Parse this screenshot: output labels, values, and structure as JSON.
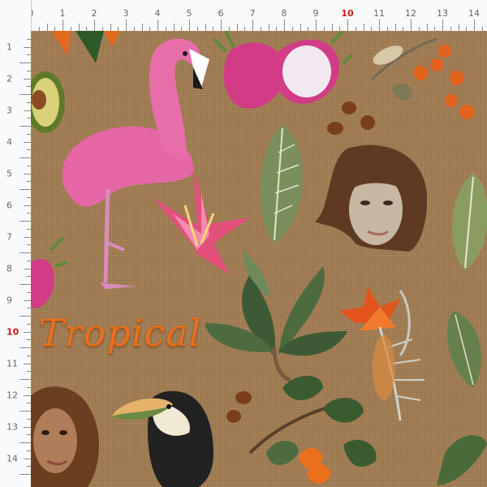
{
  "ruler": {
    "top_labels": [
      "0",
      "1",
      "2",
      "3",
      "4",
      "5",
      "6",
      "7",
      "8",
      "9",
      "10",
      "11",
      "12",
      "13",
      "14"
    ],
    "left_labels": [
      "1",
      "2",
      "3",
      "4",
      "5",
      "6",
      "7",
      "8",
      "9",
      "10",
      "11",
      "12",
      "13",
      "14"
    ],
    "highlight": "10",
    "label_color": "#c9151b"
  },
  "pattern": {
    "word": "Tropical",
    "word_color": "#e8701d",
    "background_color": "#a77f53",
    "motifs": [
      "flamingo-icon",
      "dragon-fruit-icon",
      "orange-berries-icon",
      "avocado-icon",
      "leaf-icon",
      "lily-icon",
      "woman-face-icon",
      "tropical-plant-icon",
      "bird-of-paradise-icon",
      "toucan-icon",
      "curly-hair-woman-icon",
      "seeds-icon"
    ]
  }
}
